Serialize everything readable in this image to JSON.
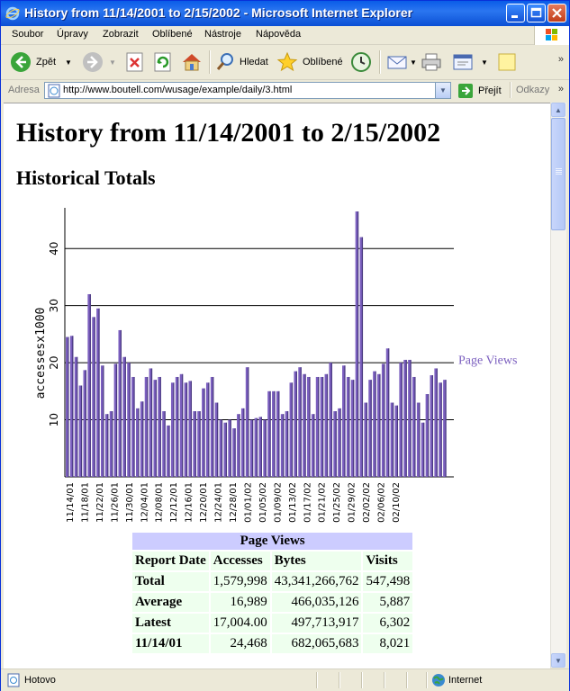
{
  "window": {
    "title": "History from 11/14/2001 to 2/15/2002 - Microsoft Internet Explorer"
  },
  "menu": [
    "Soubor",
    "Úpravy",
    "Zobrazit",
    "Oblíbené",
    "Nástroje",
    "Nápověda"
  ],
  "toolbar": {
    "back": "Zpět",
    "search": "Hledat",
    "favorites": "Oblíbené"
  },
  "address": {
    "label": "Adresa",
    "url": "http://www.boutell.com/wusage/example/daily/3.html",
    "go": "Přejít",
    "links": "Odkazy"
  },
  "page": {
    "title": "History from 11/14/2001 to 2/15/2002",
    "subtitle": "Historical Totals"
  },
  "chart_data": {
    "type": "bar",
    "ylabel": "accessesx1000",
    "ylim": [
      0,
      46.5
    ],
    "yticks": [
      10,
      20,
      30,
      40
    ],
    "grid": true,
    "legend": "right",
    "series": [
      {
        "name": "Page Views",
        "color": "#7b5fbf",
        "values": [
          24.5,
          24.7,
          21,
          16,
          18.7,
          32,
          28,
          29.5,
          19.5,
          11,
          11.5,
          19.8,
          25.7,
          21,
          20,
          17.5,
          12,
          13.2,
          17.5,
          19,
          17,
          17.5,
          11.5,
          9,
          16.5,
          17.5,
          18,
          16.5,
          16.8,
          11.5,
          11.5,
          15.5,
          16.5,
          17.5,
          13,
          10,
          9.5,
          10,
          8.5,
          11,
          12,
          19.2,
          10,
          10.3,
          10.5,
          10,
          15,
          15,
          15,
          11,
          11.5,
          16.5,
          18.5,
          19.2,
          18,
          17.5,
          11,
          17.5,
          17.5,
          18,
          20,
          11.5,
          12,
          19.5,
          17.5,
          17,
          46.5,
          42,
          13,
          17,
          18.5,
          18,
          19.8,
          22.5,
          13,
          12.5,
          20,
          20.5,
          20.5,
          17.5,
          13,
          9.5,
          14.5,
          17.8,
          19,
          16.5,
          17
        ]
      }
    ],
    "xtick_labels": [
      "11/14/01",
      "11/18/01",
      "11/22/01",
      "11/26/01",
      "11/30/01",
      "12/04/01",
      "12/08/01",
      "12/12/01",
      "12/16/01",
      "12/20/01",
      "12/24/01",
      "12/28/01",
      "01/01/02",
      "01/05/02",
      "01/09/02",
      "01/13/02",
      "01/17/02",
      "01/21/02",
      "01/25/02",
      "01/29/02",
      "02/02/02",
      "02/06/02",
      "02/10/02"
    ]
  },
  "table": {
    "header": "Page Views",
    "columns": [
      "Report Date",
      "Accesses",
      "Bytes",
      "Visits"
    ],
    "rows": [
      {
        "label": "Total",
        "accesses": "1,579,998",
        "bytes": "43,341,266,762",
        "visits": "547,498"
      },
      {
        "label": "Average",
        "accesses": "16,989",
        "bytes": "466,035,126",
        "visits": "5,887"
      },
      {
        "label": "Latest",
        "accesses": "17,004.00",
        "bytes": "497,713,917",
        "visits": "6,302"
      },
      {
        "label": "11/14/01",
        "accesses": "24,468",
        "bytes": "682,065,683",
        "visits": "8,021"
      }
    ]
  },
  "status": {
    "text": "Hotovo",
    "zone": "Internet"
  }
}
